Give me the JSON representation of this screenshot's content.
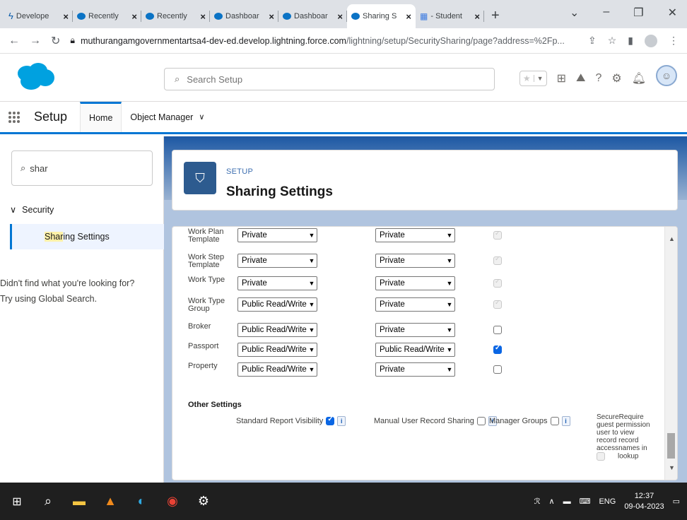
{
  "browser": {
    "tabs": [
      {
        "title": "Develope",
        "icon": "bolt-icon"
      },
      {
        "title": "Recently",
        "icon": "cloud-icon"
      },
      {
        "title": "Recently",
        "icon": "cloud-icon"
      },
      {
        "title": "Dashboar",
        "icon": "cloud-icon"
      },
      {
        "title": "Dashboar",
        "icon": "cloud-icon"
      },
      {
        "title": "Sharing S",
        "icon": "cloud-icon",
        "active": true
      },
      {
        "title": "- Student",
        "icon": "doc-icon"
      }
    ],
    "url_domain": "muthurangamgovernmentartsa4-dev-ed.develop.lightning.force.com",
    "url_path": "/lightning/setup/SecuritySharing/page?address=%2Fp..."
  },
  "header": {
    "search_placeholder": "Search Setup"
  },
  "setup_nav": {
    "title": "Setup",
    "tab_home": "Home",
    "tab_object_manager": "Object Manager"
  },
  "sidebar": {
    "quickfind_value": "shar",
    "section": "Security",
    "item_highlight": "Shar",
    "item_rest": "ing Settings",
    "notfound_line1": "Didn't find what you're looking for?",
    "notfound_line2": "Try using Global Search."
  },
  "page": {
    "eyebrow": "SETUP",
    "title": "Sharing Settings"
  },
  "rows": [
    {
      "label": "Work Plan Template",
      "default_access": "Private",
      "external_access": "Private",
      "check": "disabled"
    },
    {
      "label": "Work Step Template",
      "default_access": "Private",
      "external_access": "Private",
      "check": "disabled"
    },
    {
      "label": "Work Type",
      "default_access": "Private",
      "external_access": "Private",
      "check": "disabled"
    },
    {
      "label": "Work Type Group",
      "default_access": "Public Read/Write",
      "external_access": "Private",
      "check": "disabled"
    },
    {
      "label": "Broker",
      "default_access": "Public Read/Write",
      "external_access": "Private",
      "check": "off"
    },
    {
      "label": "Passport",
      "default_access": "Public Read/Write",
      "external_access": "Public Read/Write",
      "check": "on"
    },
    {
      "label": "Property",
      "default_access": "Public Read/Write",
      "external_access": "Private",
      "check": "off"
    }
  ],
  "other_settings": {
    "title": "Other Settings",
    "standard_report_visibility": "Standard Report Visibility",
    "manual_user_record_sharing": "Manual User Record Sharing",
    "manager_groups": "Manager Groups",
    "secure_guest_col1": "SecureRequire",
    "secure_guest_col2": "guest permission",
    "secure_guest_col3": "user to view",
    "secure_guest_col4": "record record",
    "secure_guest_col5": "accessnames in",
    "secure_guest_col6": "lookup"
  },
  "taskbar": {
    "lang": "ENG",
    "time": "12:37",
    "date": "09-04-2023"
  },
  "colors": {
    "brand": "#0176d3",
    "salesforce_cloud": "#00a1e0"
  }
}
